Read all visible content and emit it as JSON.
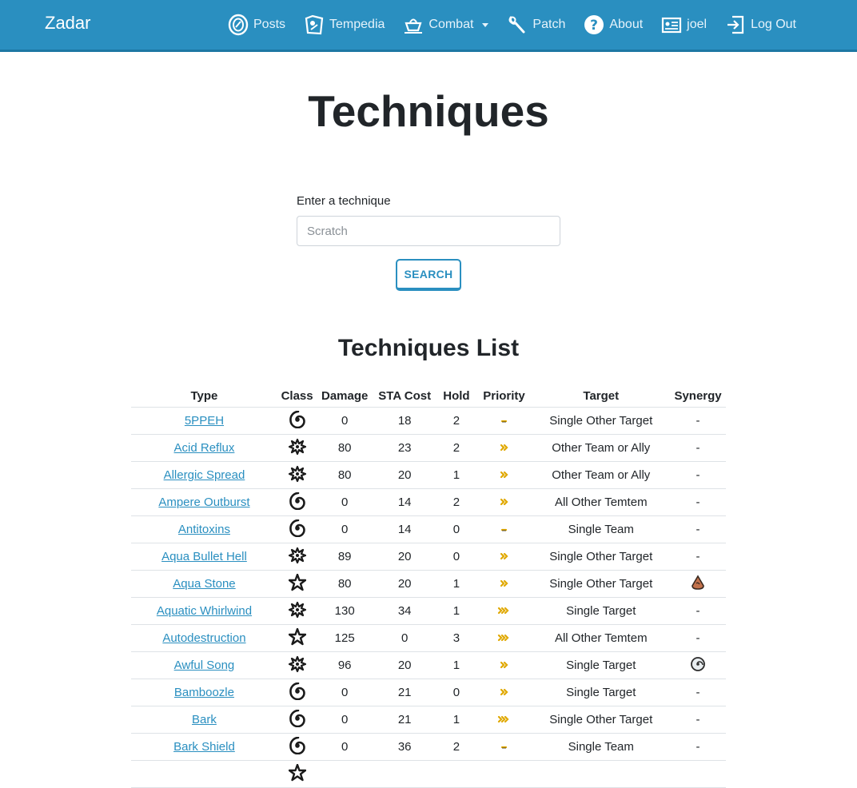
{
  "brand": "Zadar",
  "nav": [
    {
      "label": "Posts",
      "icon": "posts-icon"
    },
    {
      "label": "Tempedia",
      "icon": "tempedia-icon"
    },
    {
      "label": "Combat",
      "icon": "combat-icon",
      "dropdown": true
    },
    {
      "label": "Patch",
      "icon": "wrench-icon"
    },
    {
      "label": "About",
      "icon": "question-icon"
    },
    {
      "label": "joel",
      "icon": "profile-card-icon"
    },
    {
      "label": "Log Out",
      "icon": "logout-icon"
    }
  ],
  "page": {
    "title": "Techniques",
    "list_title": "Techniques List"
  },
  "search": {
    "label": "Enter a technique",
    "placeholder": "Scratch",
    "button": "SEARCH"
  },
  "table": {
    "headers": [
      "Type",
      "Class",
      "Damage",
      "STA Cost",
      "Hold",
      "Priority",
      "Target",
      "Synergy"
    ],
    "rows": [
      {
        "name": "5PPEH",
        "class": "status",
        "damage": "0",
        "sta": "18",
        "hold": "2",
        "priority": "low",
        "target": "Single Other Target",
        "synergy": "-"
      },
      {
        "name": "Acid Reflux",
        "class": "special",
        "damage": "80",
        "sta": "23",
        "hold": "2",
        "priority": "normal",
        "target": "Other Team or Ally",
        "synergy": "-"
      },
      {
        "name": "Allergic Spread",
        "class": "special",
        "damage": "80",
        "sta": "20",
        "hold": "1",
        "priority": "normal",
        "target": "Other Team or Ally",
        "synergy": "-"
      },
      {
        "name": "Ampere Outburst",
        "class": "status",
        "damage": "0",
        "sta": "14",
        "hold": "2",
        "priority": "normal",
        "target": "All Other Temtem",
        "synergy": "-"
      },
      {
        "name": "Antitoxins",
        "class": "status",
        "damage": "0",
        "sta": "14",
        "hold": "0",
        "priority": "low",
        "target": "Single Team",
        "synergy": "-"
      },
      {
        "name": "Aqua Bullet Hell",
        "class": "special",
        "damage": "89",
        "sta": "20",
        "hold": "0",
        "priority": "normal",
        "target": "Single Other Target",
        "synergy": "-"
      },
      {
        "name": "Aqua Stone",
        "class": "physical",
        "damage": "80",
        "sta": "20",
        "hold": "1",
        "priority": "normal",
        "target": "Single Other Target",
        "synergy": "earth"
      },
      {
        "name": "Aquatic Whirlwind",
        "class": "special",
        "damage": "130",
        "sta": "34",
        "hold": "1",
        "priority": "high",
        "target": "Single Target",
        "synergy": "-"
      },
      {
        "name": "Autodestruction",
        "class": "physical",
        "damage": "125",
        "sta": "0",
        "hold": "3",
        "priority": "high",
        "target": "All Other Temtem",
        "synergy": "-"
      },
      {
        "name": "Awful Song",
        "class": "special",
        "damage": "96",
        "sta": "20",
        "hold": "1",
        "priority": "normal",
        "target": "Single Target",
        "synergy": "wind"
      },
      {
        "name": "Bamboozle",
        "class": "status",
        "damage": "0",
        "sta": "21",
        "hold": "0",
        "priority": "normal",
        "target": "Single Target",
        "synergy": "-"
      },
      {
        "name": "Bark",
        "class": "status",
        "damage": "0",
        "sta": "21",
        "hold": "1",
        "priority": "high",
        "target": "Single Other Target",
        "synergy": "-"
      },
      {
        "name": "Bark Shield",
        "class": "status",
        "damage": "0",
        "sta": "36",
        "hold": "2",
        "priority": "low",
        "target": "Single Team",
        "synergy": "-"
      },
      {
        "name": "",
        "class": "physical",
        "damage": "",
        "sta": "",
        "hold": "",
        "priority": "",
        "target": "",
        "synergy": ""
      }
    ]
  },
  "colors": {
    "navbar": "#2a8fc0",
    "link": "#2a8fc0",
    "priority": "#e0a800"
  }
}
